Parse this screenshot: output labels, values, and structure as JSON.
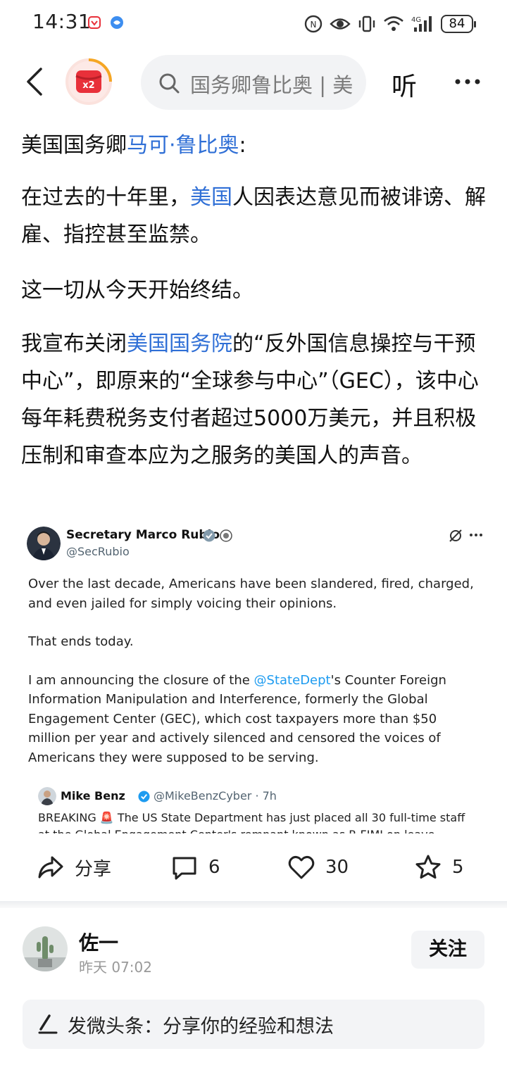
{
  "status_bar": {
    "time": "14:31",
    "battery": "84",
    "network": "4G"
  },
  "nav": {
    "search_text": "国务卿鲁比奥 | 美",
    "listen_label": "听"
  },
  "article": {
    "p1_prefix": "美国国务卿",
    "p1_link": "马可·鲁比奥",
    "p1_suffix": ":",
    "p2_prefix": "在过去的十年里，",
    "p2_link": "美国",
    "p2_suffix": "人因表达意见而被诽谤、解雇、指控甚至监禁。",
    "p3": "这一切从今天开始终结。",
    "p4_prefix": "我宣布关闭",
    "p4_link": "美国国务院",
    "p4_suffix": "的“反外国信息操控与干预中心”，即原来的“全球参与中心”（GEC），该中心每年耗费税务支付者超过5000万美元，并且积极压制和审查本应为之服务的美国人的声音。"
  },
  "tweet": {
    "author_name": "Secretary Marco Rubio",
    "author_handle": "@SecRubio",
    "para1": "Over the last decade, Americans have been slandered, fired, charged, and even jailed for simply voicing their opinions.",
    "para2": "That ends today.",
    "para3_prefix": "I am announcing the closure of the ",
    "para3_mention": "@StateDept",
    "para3_suffix": "'s Counter Foreign Information Manipulation and Interference, formerly the Global Engagement Center (GEC), which cost taxpayers more than $50 million per year and actively silenced and censored the voices of Americans they were supposed to be serving.",
    "quote": {
      "name": "Mike Benz",
      "handle": "@MikeBenzCyber · 7h",
      "text": "BREAKING 🚨 The US State Department has just placed all 30 full-time staff at the Global Engagement Center's remnant known as R-FIMI on leave"
    }
  },
  "actions": {
    "share_label": "分享",
    "comment_count": "6",
    "like_count": "30",
    "favorite_count": "5"
  },
  "author": {
    "name": "佐一",
    "time": "昨天  07:02",
    "follow_label": "关注"
  },
  "composer": {
    "placeholder": "发微头条：分享你的经验和想法"
  },
  "colors": {
    "link": "#2f6fd6",
    "mention": "#1d9bf0",
    "verified": "#1d9bf0",
    "logo_red": "#e8303a"
  }
}
